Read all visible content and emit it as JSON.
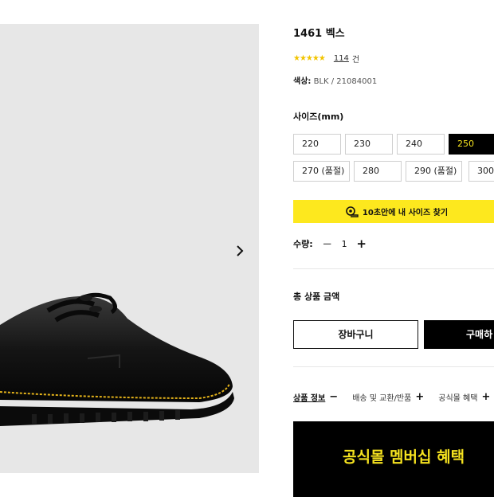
{
  "product": {
    "title": "1461 벡스",
    "stars": "★★★★★",
    "review_count": "114",
    "review_unit": "건",
    "color_label": "색상:",
    "color_value": "BLK / 21084001"
  },
  "size": {
    "label": "사이즈(mm)",
    "options": [
      "220",
      "230",
      "240",
      "250",
      "270 (품절)",
      "280",
      "290 (품절)",
      "300"
    ],
    "selected": "250"
  },
  "find_size": {
    "label": "10초안에 내 사이즈 찾기",
    "icon": "tape-measure-icon"
  },
  "quantity": {
    "label": "수량:",
    "minus": "−",
    "value": "1",
    "plus": "+"
  },
  "total": {
    "label": "총 상품 금액"
  },
  "actions": {
    "cart": "장바구니",
    "buy": "구매하"
  },
  "tabs": [
    {
      "label": "상품 정보",
      "sign": "−"
    },
    {
      "label": "배송 및 교환/반품",
      "sign": "+"
    },
    {
      "label": "공식몰 혜택",
      "sign": "+"
    }
  ],
  "banner": {
    "text": "공식몰 멤버십 혜택"
  },
  "colors": {
    "accent_yellow": "#fde81e",
    "selected_size_text": "#f5e21f",
    "star": "#f2c400"
  }
}
